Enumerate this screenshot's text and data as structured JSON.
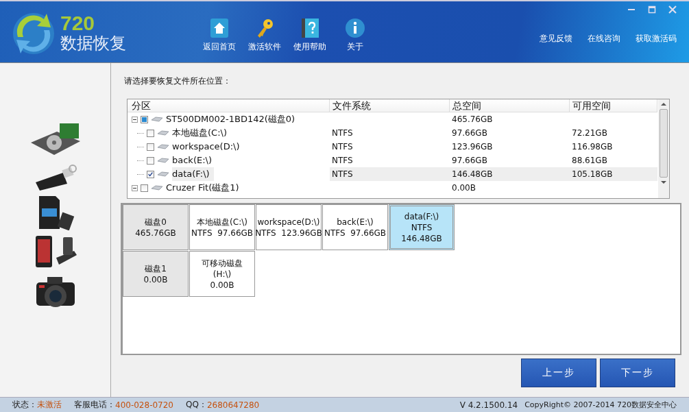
{
  "app": {
    "logo_number": "720",
    "logo_text": "数据恢复"
  },
  "toolbar": [
    {
      "label": "返回首页",
      "kind": "home"
    },
    {
      "label": "激活软件",
      "kind": "key"
    },
    {
      "label": "使用帮助",
      "kind": "help"
    },
    {
      "label": "关于",
      "kind": "info"
    }
  ],
  "header_links": [
    "意见反馈",
    "在线咨询",
    "获取激活码"
  ],
  "prompt": "请选择要恢复文件所在位置：",
  "tree": {
    "columns": [
      "分区",
      "文件系统",
      "总空间",
      "可用空间"
    ],
    "rows": [
      {
        "name": "ST500DM002-1BD142(磁盘0)",
        "fs": "",
        "total": "465.76GB",
        "free": "",
        "expanded": true,
        "checked": false,
        "partial": true,
        "selected": false,
        "children": [
          {
            "name": "本地磁盘(C:\\)",
            "fs": "NTFS",
            "total": "97.66GB",
            "free": "72.21GB",
            "checked": false,
            "partial": false,
            "selected": false
          },
          {
            "name": "workspace(D:\\)",
            "fs": "NTFS",
            "total": "123.96GB",
            "free": "116.98GB",
            "checked": false,
            "partial": false,
            "selected": false
          },
          {
            "name": "back(E:\\)",
            "fs": "NTFS",
            "total": "97.66GB",
            "free": "88.61GB",
            "checked": false,
            "partial": false,
            "selected": false
          },
          {
            "name": "data(F:\\)",
            "fs": "NTFS",
            "total": "146.48GB",
            "free": "105.18GB",
            "checked": true,
            "partial": false,
            "selected": true
          }
        ]
      },
      {
        "name": "Cruzer Fit(磁盘1)",
        "fs": "",
        "total": "0.00B",
        "free": "",
        "expanded": true,
        "checked": false,
        "partial": false,
        "selected": false,
        "children": []
      }
    ]
  },
  "tiles": [
    [
      {
        "kind": "disk",
        "lines": [
          "磁盘0",
          "465.76GB"
        ],
        "selected": false
      },
      {
        "kind": "partition",
        "lines": [
          "本地磁盘(C:\\)",
          "NTFS  97.66GB"
        ],
        "selected": false
      },
      {
        "kind": "partition",
        "lines": [
          "workspace(D:\\)",
          "NTFS  123.96GB"
        ],
        "selected": false
      },
      {
        "kind": "partition",
        "lines": [
          "back(E:\\)",
          "NTFS  97.66GB"
        ],
        "selected": false
      },
      {
        "kind": "partition",
        "lines": [
          "data(F:\\)",
          "NTFS",
          "146.48GB"
        ],
        "selected": true
      }
    ],
    [
      {
        "kind": "disk",
        "lines": [
          "磁盘1",
          "0.00B"
        ],
        "selected": false
      },
      {
        "kind": "partition",
        "lines": [
          "可移动磁盘",
          "(H:\\)",
          "0.00B"
        ],
        "selected": false
      }
    ]
  ],
  "buttons": [
    "上一步",
    "下一步"
  ],
  "status_bar": {
    "state_label": "状态：",
    "state": "未激活",
    "phone_label": "客服电话：",
    "phone": "400-028-0720",
    "qq_label": "QQ：",
    "qq": "2680647280",
    "version": "V 4.2.1500.14",
    "copyright": "CopyRight© 2007-2014 720数据安全中心"
  }
}
